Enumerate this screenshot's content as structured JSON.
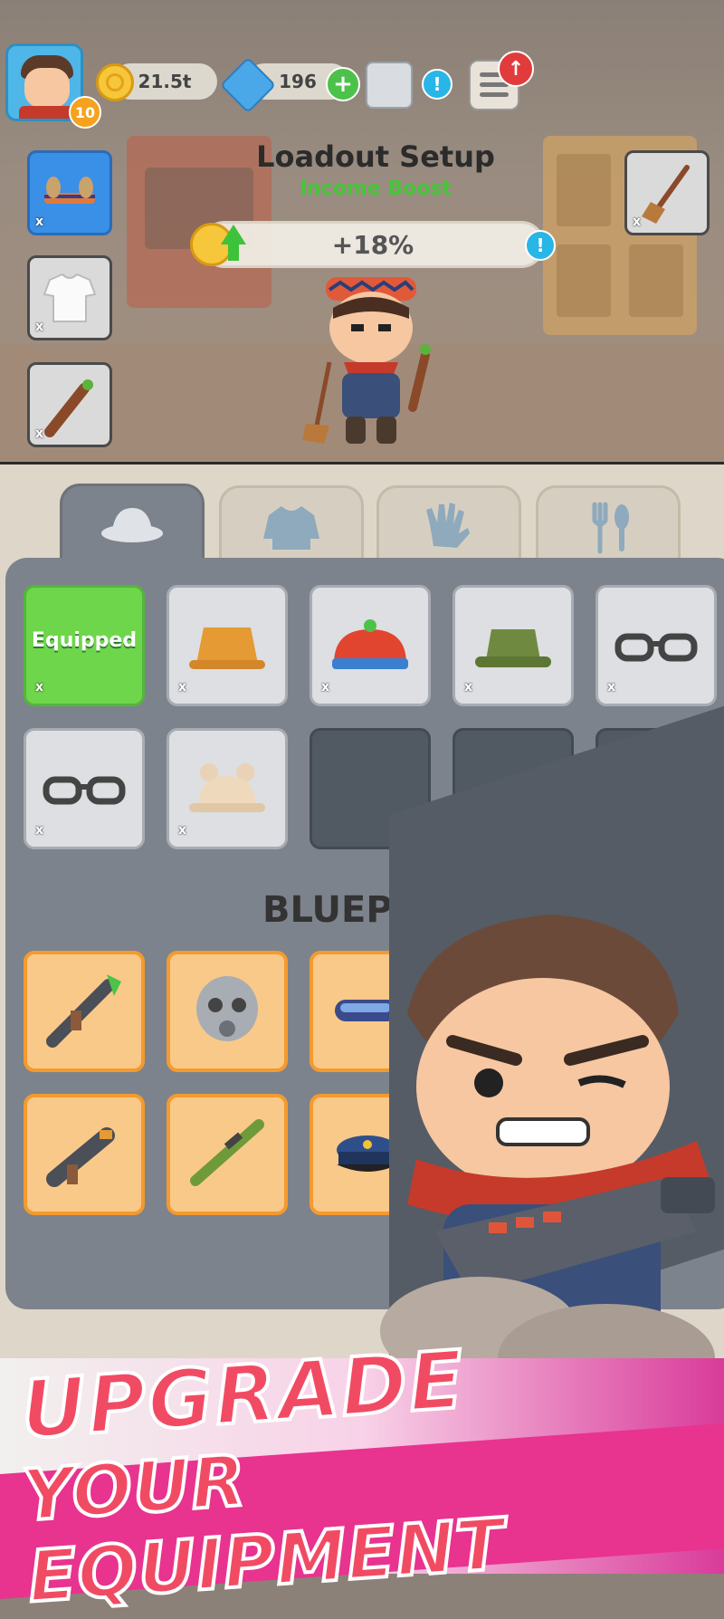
{
  "header": {
    "player_level": "10",
    "coins": "21.5t",
    "gems": "196"
  },
  "loadout": {
    "title": "Loadout Setup",
    "subtitle": "Income Boost",
    "boost_value": "+18%",
    "slot_marker": "x"
  },
  "inventory": {
    "tabs": [
      "hat-icon",
      "shirt-icon",
      "glove-icon",
      "utensils-icon"
    ],
    "equipped_label": "Equipped",
    "item_marker": "x"
  },
  "blueprint": {
    "title": "BLUEPRINT"
  },
  "promo": {
    "line1": "UPGRADE",
    "line2": "YOUR EQUIPMENT"
  },
  "colors": {
    "income_green": "#49c43b",
    "equipped_green": "#6ed64a",
    "blueprint_orange": "#f49a2e",
    "promo_pink": "#f14b63"
  }
}
